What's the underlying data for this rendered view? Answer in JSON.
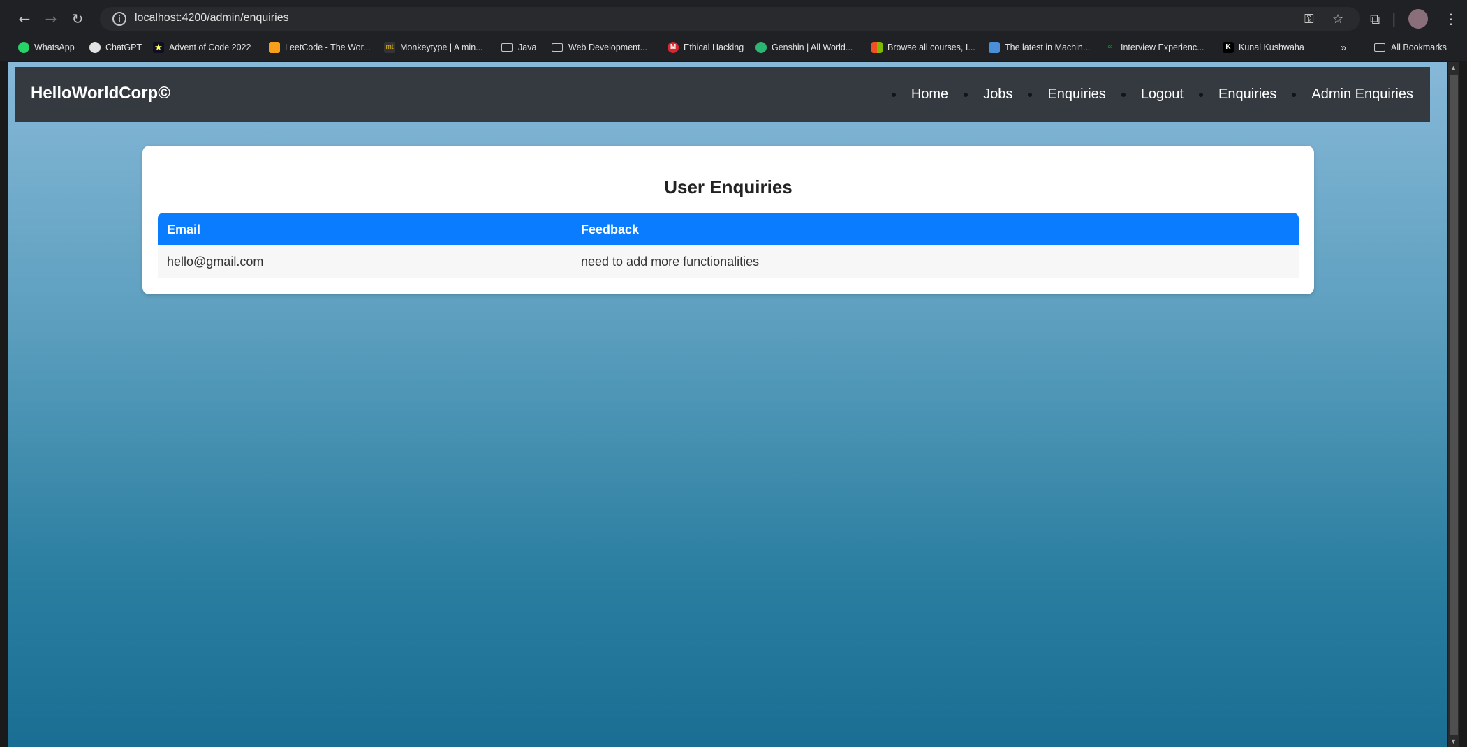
{
  "browser": {
    "url": "localhost:4200/admin/enquiries",
    "bookmarks": [
      {
        "label": "WhatsApp",
        "icon": "whatsapp-icon"
      },
      {
        "label": "ChatGPT",
        "icon": "chatgpt-icon"
      },
      {
        "label": "Advent of Code 2022",
        "icon": "star-icon"
      },
      {
        "label": "LeetCode - The Wor...",
        "icon": "leetcode-icon"
      },
      {
        "label": "Monkeytype | A min...",
        "icon": "monkeytype-icon"
      },
      {
        "label": "Java",
        "icon": "folder-icon"
      },
      {
        "label": "Web Development...",
        "icon": "folder-icon"
      },
      {
        "label": "Ethical Hacking",
        "icon": "mega-icon"
      },
      {
        "label": "Genshin | All World...",
        "icon": "genshin-icon"
      },
      {
        "label": "Browse all courses, I...",
        "icon": "microsoft-icon"
      },
      {
        "label": "The latest in Machin...",
        "icon": "news-icon"
      },
      {
        "label": "Interview Experienc...",
        "icon": "gfg-icon"
      },
      {
        "label": "Kunal Kushwaha",
        "icon": "k-icon"
      }
    ],
    "overflow_label": "»",
    "all_bookmarks": "All Bookmarks"
  },
  "navbar": {
    "brand": "HelloWorldCorp©",
    "links": [
      "Home",
      "Jobs",
      "Enquiries",
      "Logout",
      "Enquiries",
      "Admin Enquiries"
    ]
  },
  "main": {
    "title": "User Enquiries",
    "columns": [
      "Email",
      "Feedback"
    ],
    "rows": [
      [
        "hello@gmail.com",
        "need to add more functionalities"
      ]
    ]
  },
  "colors": {
    "navbar_bg": "#353a40",
    "table_header": "#0a7cff",
    "chrome_bg": "#202124"
  }
}
